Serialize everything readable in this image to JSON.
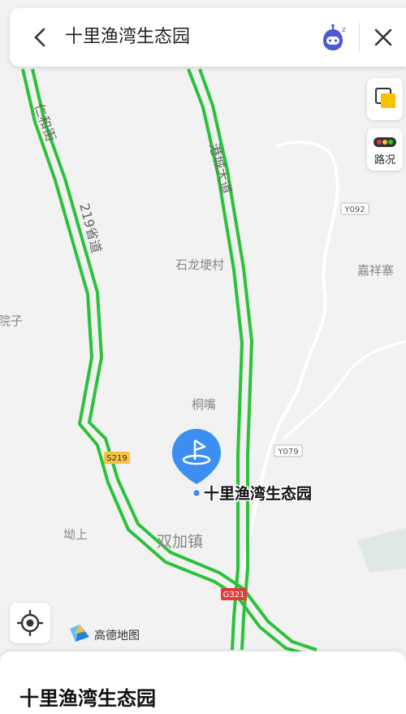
{
  "search": {
    "title": "十里渔湾生态园"
  },
  "controls": {
    "traffic_label": "路况"
  },
  "map": {
    "place_labels": [
      "石龙埂村",
      "嘉祥寨",
      "院子",
      "桐嘴",
      "坳上",
      "双加镇"
    ],
    "road_labels": [
      "仁和街",
      "219省道",
      "港城大道"
    ],
    "road_badges": [
      "Y092",
      "Y079",
      "S219",
      "G321"
    ],
    "poi": {
      "name": "十里渔湾生态园",
      "color": "#3b8ff2"
    },
    "colors": {
      "road": "#2bc23b",
      "background": "#f2f2f2"
    }
  },
  "brand": {
    "logo_text": "高德地图"
  },
  "sheet": {
    "title": "十里渔湾生态园"
  }
}
